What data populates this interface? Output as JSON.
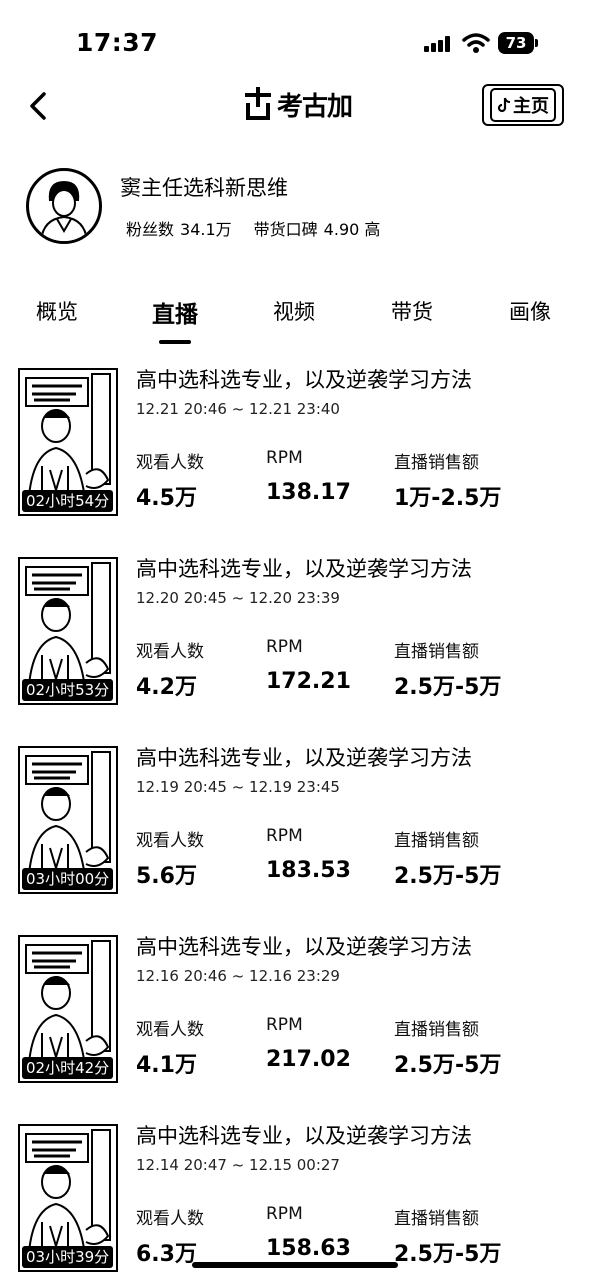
{
  "status_bar": {
    "time": "17:37",
    "battery": "73"
  },
  "header": {
    "logo_text": "考古加",
    "home_button": "主页"
  },
  "profile": {
    "name": "窦主任选科新思维",
    "fans_label": "粉丝数",
    "fans_value": "34.1万",
    "reputation_label": "带货口碑",
    "reputation_value": "4.90 高"
  },
  "tabs": [
    "概览",
    "直播",
    "视频",
    "带货",
    "画像"
  ],
  "active_tab": "直播",
  "metric_labels": {
    "viewers": "观看人数",
    "rpm": "RPM",
    "sales": "直播销售额"
  },
  "live_list": [
    {
      "title": "高中选科选专业，以及逆袭学习方法",
      "time": "12.21 20:46 ~ 12.21 23:40",
      "duration": "02小时54分",
      "viewers": "4.5万",
      "rpm": "138.17",
      "sales": "1万-2.5万"
    },
    {
      "title": "高中选科选专业，以及逆袭学习方法",
      "time": "12.20 20:45 ~ 12.20 23:39",
      "duration": "02小时53分",
      "viewers": "4.2万",
      "rpm": "172.21",
      "sales": "2.5万-5万"
    },
    {
      "title": "高中选科选专业，以及逆袭学习方法",
      "time": "12.19 20:45 ~ 12.19 23:45",
      "duration": "03小时00分",
      "viewers": "5.6万",
      "rpm": "183.53",
      "sales": "2.5万-5万"
    },
    {
      "title": "高中选科选专业，以及逆袭学习方法",
      "time": "12.16 20:46 ~ 12.16 23:29",
      "duration": "02小时42分",
      "viewers": "4.1万",
      "rpm": "217.02",
      "sales": "2.5万-5万"
    },
    {
      "title": "高中选科选专业，以及逆袭学习方法",
      "time": "12.14 20:47 ~ 12.15 00:27",
      "duration": "03小时39分",
      "viewers": "6.3万",
      "rpm": "158.63",
      "sales": "2.5万-5万"
    }
  ]
}
